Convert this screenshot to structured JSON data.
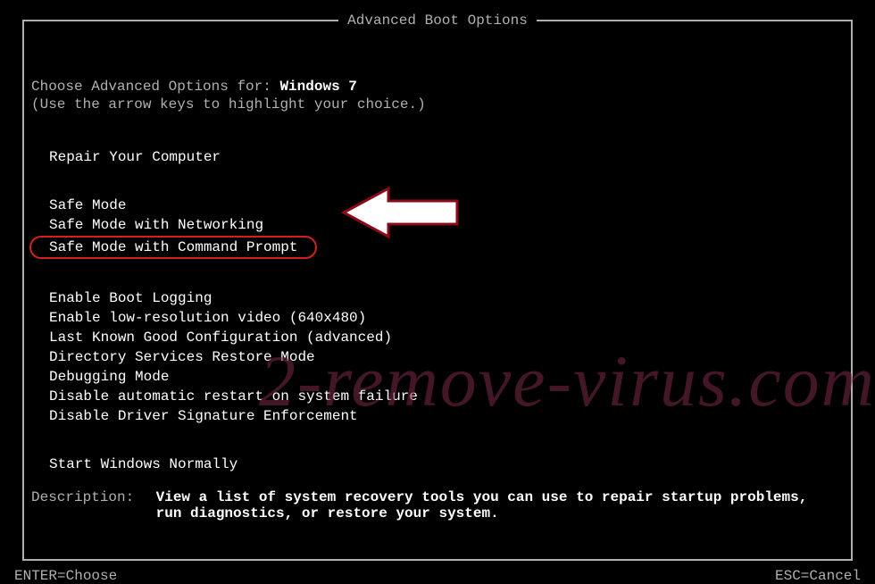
{
  "title": "Advanced Boot Options",
  "prompt_prefix": "Choose Advanced Options for: ",
  "os": "Windows 7",
  "hint": "(Use the arrow keys to highlight your choice.)",
  "menu": {
    "group1": [
      "Repair Your Computer"
    ],
    "group2": [
      "Safe Mode",
      "Safe Mode with Networking",
      "Safe Mode with Command Prompt"
    ],
    "group3": [
      "Enable Boot Logging",
      "Enable low-resolution video (640x480)",
      "Last Known Good Configuration (advanced)",
      "Directory Services Restore Mode",
      "Debugging Mode",
      "Disable automatic restart on system failure",
      "Disable Driver Signature Enforcement"
    ],
    "group4": [
      "Start Windows Normally"
    ],
    "highlighted_label": "Safe Mode with Command Prompt"
  },
  "description": {
    "label": "Description:",
    "text": "View a list of system recovery tools you can use to repair startup problems, run diagnostics, or restore your system."
  },
  "footer": {
    "left": "ENTER=Choose",
    "right": "ESC=Cancel"
  },
  "watermark": "2-remove-virus.com"
}
